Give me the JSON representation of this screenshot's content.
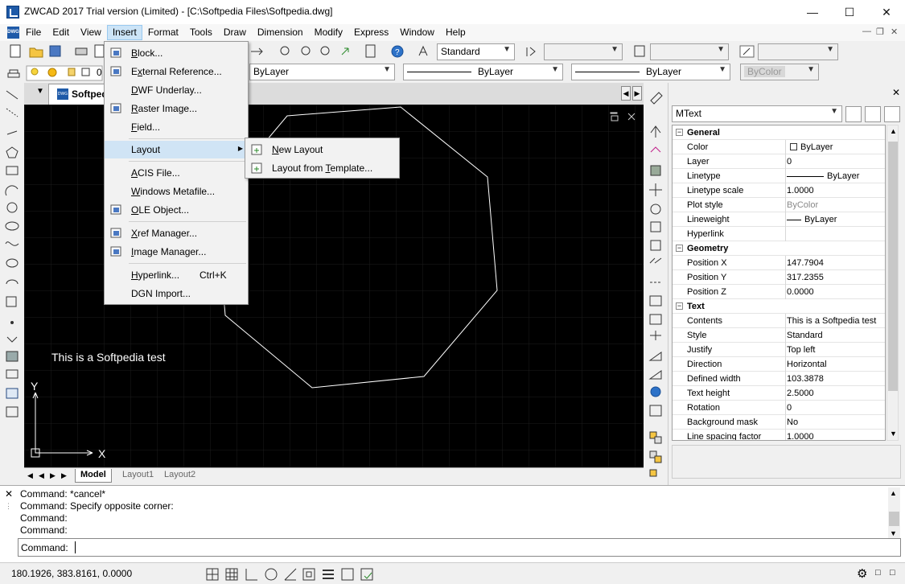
{
  "window": {
    "title": "ZWCAD 2017 Trial version (Limited) - [C:\\Softpedia Files\\Softpedia.dwg]"
  },
  "menubar": {
    "items": [
      "File",
      "Edit",
      "View",
      "Insert",
      "Format",
      "Tools",
      "Draw",
      "Dimension",
      "Modify",
      "Express",
      "Window",
      "Help"
    ],
    "active": "Insert"
  },
  "toolbar": {
    "text_style": "Standard",
    "layer_value": "0",
    "linetype": "ByLayer",
    "lineweight": "ByLayer",
    "color": "ByLayer",
    "plotstyle": "ByColor"
  },
  "document": {
    "tab": "Softpedia"
  },
  "canvas": {
    "text": "This is a Softpedia test",
    "axis_y": "Y",
    "axis_x": "X"
  },
  "layout_tabs": [
    "Model",
    "Layout1",
    "Layout2"
  ],
  "insert_menu": {
    "items": [
      {
        "label": "Block...",
        "accel": "B",
        "icon": "block-icon"
      },
      {
        "label": "External Reference...",
        "accel": "x",
        "icon": "xref-icon"
      },
      {
        "label": "DWF Underlay...",
        "accel": "D",
        "icon": ""
      },
      {
        "label": "Raster Image...",
        "accel": "R",
        "icon": "raster-image-icon"
      },
      {
        "label": "Field...",
        "accel": "F",
        "icon": ""
      },
      {
        "label": "Layout",
        "accel": "",
        "icon": ""
      },
      {
        "label": "ACIS File...",
        "accel": "A",
        "icon": ""
      },
      {
        "label": "Windows Metafile...",
        "accel": "W",
        "icon": ""
      },
      {
        "label": "OLE Object...",
        "accel": "O",
        "icon": "ole-object-icon"
      },
      {
        "label": "Xref Manager...",
        "accel": "X",
        "icon": "xref-manager-icon"
      },
      {
        "label": "Image Manager...",
        "accel": "I",
        "icon": "image-manager-icon"
      },
      {
        "label": "Hyperlink...",
        "accel": "H",
        "icon": "",
        "shortcut": "Ctrl+K"
      },
      {
        "label": "DGN Import...",
        "accel": "",
        "icon": ""
      }
    ]
  },
  "layout_submenu": {
    "items": [
      "New Layout",
      "Layout from Template..."
    ]
  },
  "properties": {
    "object_type": "MText",
    "sections": [
      {
        "name": "General",
        "rows": [
          [
            "Color",
            "ByLayer"
          ],
          [
            "Layer",
            "0"
          ],
          [
            "Linetype",
            "ByLayer"
          ],
          [
            "Linetype scale",
            "1.0000"
          ],
          [
            "Plot style",
            "ByColor"
          ],
          [
            "Lineweight",
            "ByLayer"
          ],
          [
            "Hyperlink",
            ""
          ]
        ]
      },
      {
        "name": "Geometry",
        "rows": [
          [
            "Position X",
            "147.7904"
          ],
          [
            "Position Y",
            "317.2355"
          ],
          [
            "Position Z",
            "0.0000"
          ]
        ]
      },
      {
        "name": "Text",
        "rows": [
          [
            "Contents",
            "This is a Softpedia test"
          ],
          [
            "Style",
            "Standard"
          ],
          [
            "Justify",
            "Top left"
          ],
          [
            "Direction",
            "Horizontal"
          ],
          [
            "Defined width",
            "103.3878"
          ],
          [
            "Text height",
            "2.5000"
          ],
          [
            "Rotation",
            "0"
          ],
          [
            "Background mask",
            "No"
          ],
          [
            "Line spacing factor",
            "1.0000"
          ]
        ]
      }
    ]
  },
  "command": {
    "history": [
      "Command: *cancel*",
      "Command: Specify opposite corner:",
      "Command:",
      "Command:"
    ],
    "prompt": "Command:"
  },
  "status": {
    "coords": "180.1926, 383.8161, 0.0000"
  }
}
